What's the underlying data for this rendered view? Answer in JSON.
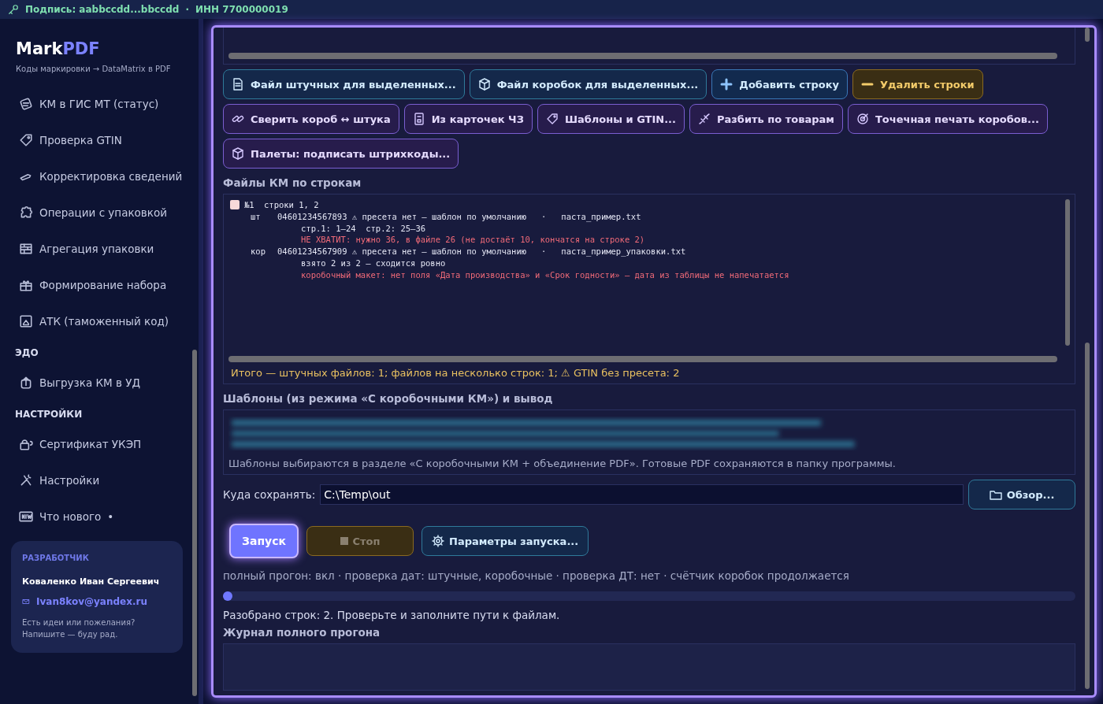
{
  "signature_bar": {
    "text": "Подпись: aabbccdd...bbccdd",
    "separator": "·",
    "inn": "ИНН 7700000019"
  },
  "sidebar": {
    "logo": {
      "main": "Mark",
      "accent": "PDF"
    },
    "subtitle": "Коды маркировки → DataMatrix в PDF",
    "sections": [
      {
        "items": [
          {
            "label": "КМ в ГИС МТ (статус)",
            "kind": "scan"
          },
          {
            "label": "Проверка GTIN",
            "kind": "tag"
          },
          {
            "label": "Корректировка сведений",
            "kind": "pencil"
          },
          {
            "label": "Операции с упаковкой",
            "kind": "puzzle"
          },
          {
            "label": "Агрегация упаковки",
            "kind": "bricks"
          },
          {
            "label": "Формирование набора",
            "kind": "gift"
          },
          {
            "label": "АТК (таможенный код)",
            "kind": "customs"
          }
        ]
      },
      {
        "title": "ЭДО",
        "items": [
          {
            "label": "Выгрузка КМ в УД",
            "kind": "upload"
          }
        ]
      },
      {
        "title": "НАСТРОЙКИ",
        "items": [
          {
            "label": "Сертификат УКЭП",
            "kind": "lock"
          },
          {
            "label": "Настройки",
            "kind": "tools"
          },
          {
            "label": "Что нового",
            "kind": "new",
            "badge": "•"
          }
        ]
      }
    ],
    "developer": {
      "title": "РАЗРАБОТЧИК",
      "name": "Коваленко Иван Сергеевич",
      "email": "Ivan8kov@yandex.ru",
      "note": "Есть идеи или пожелания?\nНапишите — буду рад."
    }
  },
  "toolbar": [
    {
      "label": "Файл штучных для выделенных...",
      "kind": "file"
    },
    {
      "label": "Файл коробок для выделенных...",
      "kind": "file"
    },
    {
      "label": "Добавить строку",
      "kind": "add"
    },
    {
      "label": "Удалить строки",
      "kind": "delete"
    },
    {
      "label": "Сверить короб ↔ штука",
      "kind": "tool"
    },
    {
      "label": "Из карточек ЧЗ",
      "kind": "tool"
    },
    {
      "label": "Шаблоны и GTIN...",
      "kind": "tool"
    },
    {
      "label": "Разбить по товарам",
      "kind": "tool"
    },
    {
      "label": "Точечная печать коробов...",
      "kind": "tool"
    },
    {
      "label": "Палеты: подписать штрихкоды...",
      "kind": "tool"
    }
  ],
  "files_panel": {
    "title": "Файлы КМ по строкам",
    "entries": [
      {
        "checked": false,
        "number": "№1",
        "rows": "строки 1, 2",
        "groups": [
          {
            "tag": "шт",
            "lines": [
              {
                "text": "04601234567893 ⚠ пресета нет — шаблон по умолчанию   ·   паста_пример.txt",
                "kind": "normal"
              },
              {
                "text": "стр.1: 1–24  стр.2: 25–36",
                "kind": "normal"
              },
              {
                "text": "НЕ ХВАТИТ: нужно 36, в файле 26 (не достаёт 10, кончатся на строке 2)",
                "kind": "error"
              }
            ]
          },
          {
            "tag": "кор",
            "lines": [
              {
                "text": "04601234567909 ⚠ пресета нет — шаблон по умолчанию   ·   паста_пример_упаковки.txt",
                "kind": "normal"
              },
              {
                "text": "взято 2 из 2 — сходится ровно",
                "kind": "normal"
              },
              {
                "text": "коробочный макет: нет поля «Дата производства» и «Срок годности» — дата из таблицы не напечатается",
                "kind": "error"
              }
            ]
          }
        ]
      }
    ],
    "summary": "Итого — штучных файлов: 1; файлов на несколько строк: 1; ⚠ GTIN без пресета: 2"
  },
  "templates_panel": {
    "title": "Шаблоны (из режима «С коробочными КМ») и вывод",
    "hint": "Шаблоны выбираются в разделе «С коробочными КМ + объединение PDF». Готовые PDF сохраняются в папку программы."
  },
  "output": {
    "label": "Куда сохранять:",
    "value": "C:\\Temp\\out",
    "browse": "Обзор..."
  },
  "actions": [
    {
      "label": "Запуск",
      "kind": "run"
    },
    {
      "label": "Стоп",
      "kind": "stop"
    },
    {
      "label": "Параметры запуска...",
      "kind": "params"
    }
  ],
  "run_summary": "полный прогон: вкл · проверка дат: штучные, коробочные · проверка ДТ: нет · счётчик коробок продолжается",
  "progress": {
    "level": 0.005
  },
  "status": "Разобрано строк: 2. Проверьте и заполните пути к файлам.",
  "log": {
    "title": "Журнал полного прогона"
  }
}
